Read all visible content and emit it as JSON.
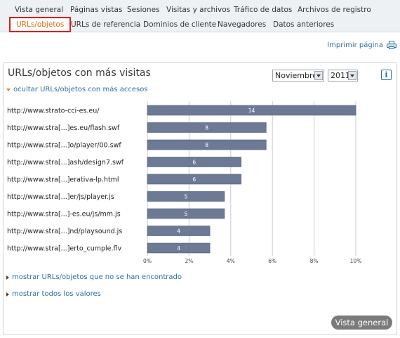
{
  "nav": {
    "row1": [
      "Vista general",
      "Páginas vistas",
      "Sesiones",
      "Visitas y archivos",
      "Tráfico de datos",
      "Archivos de registro"
    ],
    "row2": [
      "URLs/objetos",
      "URLs de referencia",
      "Dominios de cliente",
      "Navegadores",
      "Datos anteriores"
    ],
    "active_tab": "URLs/objetos"
  },
  "print_label": "Imprimir página",
  "panel": {
    "title": "URLs/objetos con más visitas",
    "month": "Noviembre",
    "year": "2011",
    "info_label": "i",
    "toggle_hide": "ocultar URLs/objetos con más accesos",
    "toggle_not_found": "mostrar URLs/objetos que no se han encontrado",
    "toggle_all_values": "mostrar todos los valores",
    "overview_button": "Vista general"
  },
  "colors": {
    "bar": "#6d7a96",
    "grid": "#c6ccd4",
    "accent": "#d96b10",
    "link": "#2e6da4",
    "active_border": "#e01b1b"
  },
  "chart_data": {
    "type": "bar",
    "orientation": "horizontal",
    "categories": [
      "http://www.strato-cci-es.eu/",
      "http://www.stra[...]es.eu/flash.swf",
      "http://www.stra[...]o/player/00.swf",
      "http://www.stra[...]ash/design7.swf",
      "http://www.stra[...]erativa-lp.html",
      "http://www.stra[...]er/js/player.js",
      "http://www.stra[...]-es.eu/js/mm.js",
      "http://www.stra[...]nd/playsound.js",
      "http://www.stra[...]erto_cumple.flv"
    ],
    "values": [
      14,
      8,
      8,
      6,
      6,
      5,
      5,
      4,
      4
    ],
    "percent": [
      10,
      5.7,
      5.7,
      4.5,
      4.5,
      3.7,
      3.7,
      3.0,
      3.0
    ],
    "xticks": [
      "0%",
      "2%",
      "4%",
      "6%",
      "8%",
      "10%"
    ],
    "xlim": [
      0,
      10
    ],
    "grid": true
  }
}
